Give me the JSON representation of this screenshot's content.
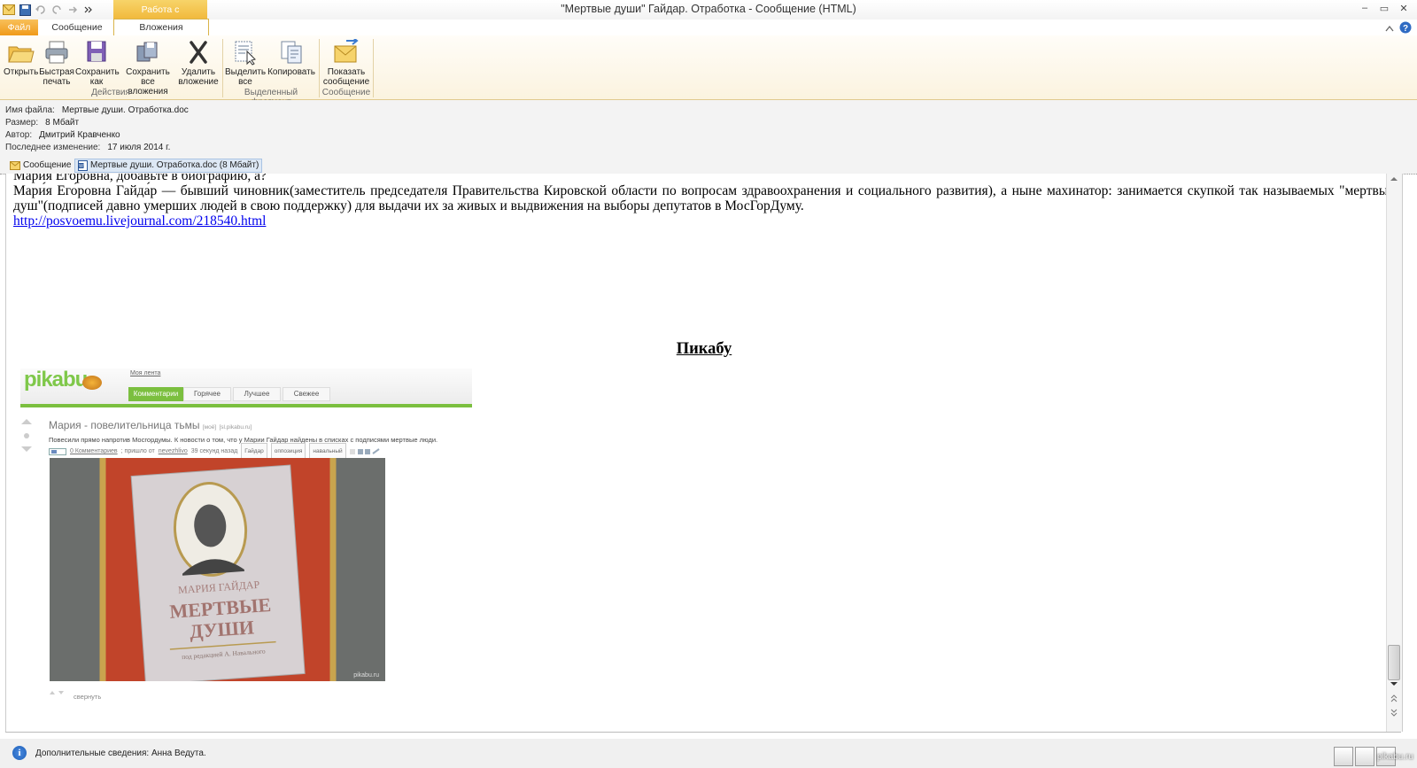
{
  "window": {
    "title": "\"Мертвые души\" Гайдар. Отработка - Сообщение (HTML)",
    "context_tab": "Работа с вложениями",
    "controls": {
      "minimize": "–",
      "restore": "▭",
      "close": "✕"
    }
  },
  "tabs": {
    "file": "Файл",
    "message": "Сообщение",
    "attachments": "Вложения"
  },
  "ribbon": {
    "open": "Открыть",
    "quick_print": "Быстрая печать",
    "save_as": "Сохранить как",
    "save_all": "Сохранить все вложения",
    "remove": "Удалить вложение",
    "select_all": "Выделить все",
    "copy": "Копировать",
    "show_message": "Показать сообщение",
    "group_actions": "Действия",
    "group_selection": "Выделенный фрагмент",
    "group_message": "Сообщение"
  },
  "info": {
    "filename_label": "Имя файла:",
    "filename": "Мертвые души. Отработка.doc",
    "size_label": "Размер:",
    "size": "8 Мбайт",
    "author_label": "Автор:",
    "author": "Дмитрий Кравченко",
    "modified_label": "Последнее изменение:",
    "modified": "17 июля 2014 г."
  },
  "attachments": {
    "message": "Сообщение",
    "doc": "Мертвые души. Отработка.doc (8 Мбайт)"
  },
  "document": {
    "line0": "Мари́я Его́ровна, добавьте в биографию, а?",
    "paragraph": "Мари́я Его́ровна Гайда́р — бывший чиновник(заместитель председателя Правительства Кировской области по вопросам здравоохранения и социального развития), а ныне махинатор: занимается скупкой так называемых \"мертвых душ\"(подписей давно умерших людей в свою поддержку) для выдачи их за живых и выдвижения на выборы депутатов в МосГорДуму.",
    "link": "http://posvoemu.livejournal.com/218540.html",
    "heading": "Пикабу"
  },
  "pikabu": {
    "logo": "pikabu",
    "my_feed": "Моя лента",
    "tabs": [
      "Комментарии",
      "Горячее",
      "Лучшее",
      "Свежее"
    ],
    "post_title": "Мария - повелительница тьмы",
    "post_mark": "[моё]",
    "post_source": "[sl.pikabu.ru]",
    "post_desc": "Повесили прямо напротив Мосгордумы. К новости о том, что у Марии Гайдар найдены в списках с подписями мертвые люди.",
    "comments": "0 Комментариев",
    "posted_by": "; пришло от",
    "author": "nevezhlivo",
    "posted_ago": "39 секунд назад",
    "tags": [
      "Гайдар",
      "оппозиция",
      "навальный"
    ],
    "book_author": "МАРИЯ ГАЙДАР",
    "book_title_1": "МЕРТВЫЕ",
    "book_title_2": "ДУШИ",
    "book_editor": "под редакцией А. Навального",
    "photo_watermark": "pikabu.ru",
    "collapse": "свернуть"
  },
  "status": {
    "text": "Дополнительные сведения: Анна Ведута.",
    "watermark": "pikabu.ru"
  }
}
